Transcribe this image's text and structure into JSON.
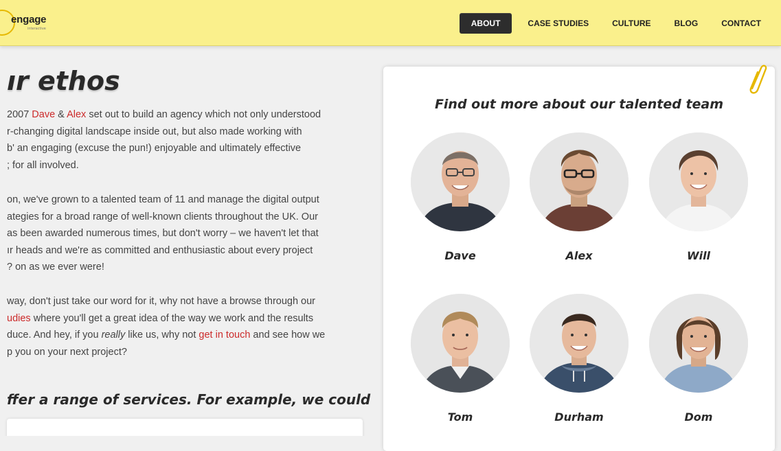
{
  "brand": {
    "name": "engage",
    "tagline": "interactive"
  },
  "nav": {
    "items": [
      {
        "label": "ABOUT",
        "active": true
      },
      {
        "label": "CASE STUDIES",
        "active": false
      },
      {
        "label": "CULTURE",
        "active": false
      },
      {
        "label": "BLOG",
        "active": false
      },
      {
        "label": "CONTACT",
        "active": false
      }
    ]
  },
  "main": {
    "heading": "ır ethos",
    "p1": {
      "l1_a": "2007 ",
      "link_dave": "Dave",
      "l1_b": " & ",
      "link_alex": "Alex",
      "l1_c": " set out to build an agency which not only understood",
      "l2": "r-changing digital landscape inside out, but also made working with",
      "l3": "b' an engaging (excuse the pun!) enjoyable and ultimately effective",
      "l4": "; for all involved."
    },
    "p2": {
      "l1": "on, we've grown to a talented team of 11 and manage the digital output",
      "l2": "ategies for a broad range of well-known clients throughout the UK. Our",
      "l3": "as been awarded numerous times, but don't worry – we haven't let that",
      "l4": "ır heads and we're as committed and enthusiastic about every project",
      "l5": "? on as we ever were!"
    },
    "p3": {
      "l1": "way, don't just take our word for it, why not have a browse through our",
      "l2_link": "udies",
      "l2_rest": " where you'll get a great idea of the way we work and the results",
      "l3_a": "duce. And hey, if you ",
      "l3_em": "really",
      "l3_b": " like us, why not ",
      "l3_link": "get in touch",
      "l3_c": " and see how we",
      "l4": "p you on your next project?"
    },
    "subheading": "ffer a range of services. For example, we could:"
  },
  "team": {
    "title": "Find out more about our talented team",
    "members": [
      {
        "name": "Dave"
      },
      {
        "name": "Alex"
      },
      {
        "name": "Will"
      },
      {
        "name": "Tom"
      },
      {
        "name": "Durham"
      },
      {
        "name": "Dom"
      }
    ]
  },
  "colors": {
    "header_bg": "#faf08c",
    "nav_active_bg": "#2d2d2d",
    "link": "#cc2b2b",
    "clip": "#e6b800"
  }
}
